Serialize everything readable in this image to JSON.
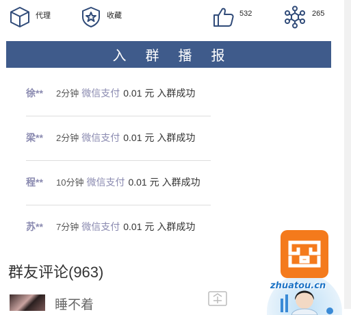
{
  "actions": {
    "agent": {
      "label": "代理",
      "icon": "cube-icon"
    },
    "favorite": {
      "label": "收藏",
      "icon": "star-badge-icon"
    },
    "like": {
      "count": "532",
      "icon": "thumbs-up-icon"
    },
    "share": {
      "count": "265",
      "icon": "share-network-icon"
    }
  },
  "broadcast": {
    "title": "入群播报",
    "items": [
      {
        "name": "徐**",
        "time": "2分钟",
        "method": "微信支付",
        "amount": "0.01 元",
        "result": "入群成功"
      },
      {
        "name": "梁**",
        "time": "2分钟",
        "method": "微信支付",
        "amount": "0.01 元",
        "result": "入群成功"
      },
      {
        "name": "程**",
        "time": "10分钟",
        "method": "微信支付",
        "amount": "0.01 元",
        "result": "入群成功"
      },
      {
        "name": "苏**",
        "time": "7分钟",
        "method": "微信支付",
        "amount": "0.01 元",
        "result": "入群成功"
      }
    ]
  },
  "comments": {
    "title": "群友评论(963)",
    "first_author": "睡不着"
  },
  "floating": {
    "watermark": "zhuatou.cn"
  },
  "colors": {
    "banner": "#3f5b8b",
    "icon_stroke": "#2f4a78",
    "muted_text": "#8a8ab0",
    "app_orange": "#f47a1c"
  }
}
